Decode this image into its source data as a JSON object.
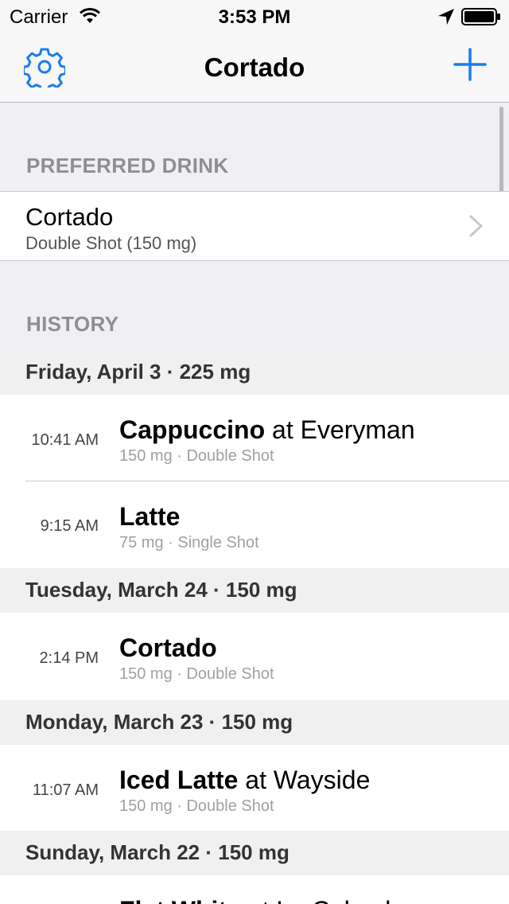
{
  "status_bar": {
    "carrier": "Carrier",
    "time": "3:53 PM"
  },
  "nav": {
    "title": "Cortado"
  },
  "preferred": {
    "section_title": "PREFERRED DRINK",
    "name": "Cortado",
    "detail": "Double Shot (150 mg)"
  },
  "history": {
    "section_title": "HISTORY",
    "days": [
      {
        "header": "Friday, April 3 · 225 mg",
        "entries": [
          {
            "time": "10:41 AM",
            "drink": "Cappuccino",
            "place": " at Everyman",
            "detail": "150 mg · Double Shot"
          },
          {
            "time": "9:15 AM",
            "drink": "Latte",
            "place": "",
            "detail": "75 mg · Single Shot"
          }
        ]
      },
      {
        "header": "Tuesday, March 24 · 150 mg",
        "entries": [
          {
            "time": "2:14 PM",
            "drink": "Cortado",
            "place": "",
            "detail": "150 mg · Double Shot"
          }
        ]
      },
      {
        "header": "Monday, March 23 · 150 mg",
        "entries": [
          {
            "time": "11:07 AM",
            "drink": "Iced Latte",
            "place": " at Wayside",
            "detail": "150 mg · Double Shot"
          }
        ]
      },
      {
        "header": "Sunday, March 22 · 150 mg",
        "entries": [
          {
            "time": "",
            "drink": "Flat White",
            "place": " at La Colombe",
            "detail": ""
          }
        ]
      }
    ]
  },
  "colors": {
    "tint": "#1a7cf0",
    "background": "#efeff4"
  }
}
